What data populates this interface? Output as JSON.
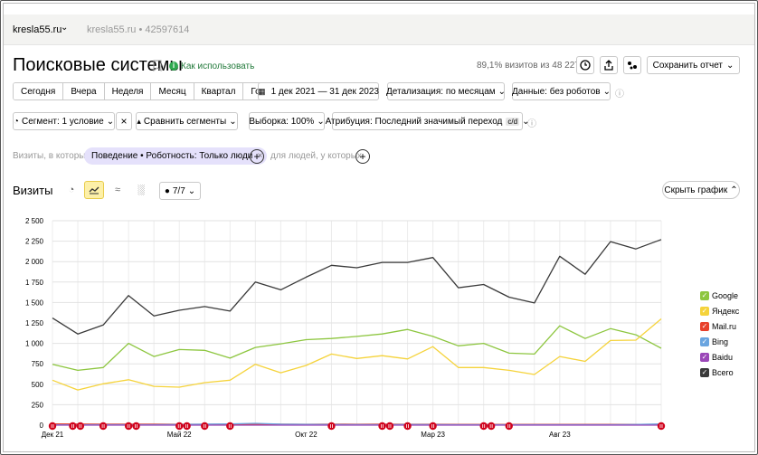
{
  "header": {
    "counter_name": "kresla55.ru",
    "counter_meta": "kresla55.ru • 42597614"
  },
  "page": {
    "title": "Поисковые системы",
    "howto": "Как использовать",
    "sample_info": "89,1% визитов из 48 227"
  },
  "toolbar": {
    "save_report": "Сохранить отчет"
  },
  "periods": [
    "Сегодня",
    "Вчера",
    "Неделя",
    "Месяц",
    "Квартал",
    "Год"
  ],
  "date_range": "1 дек 2021 — 31 дек 2023",
  "detail": "Детализация: по месяцам",
  "data_filter": "Данные: без роботов",
  "filters": {
    "segment": "Сегмент: 1 условие",
    "compare": "Сравнить сегменты",
    "sampling": "Выборка: 100%",
    "attribution": "Атрибуция: Последний значимый переход",
    "attribution_badge": "c/d"
  },
  "conditions": {
    "label": "Визиты, в которых",
    "chip": "Поведение • Роботность: Только люди",
    "people_label": "для людей, у которых"
  },
  "chart_header": {
    "title": "Визиты",
    "series_count": "7/7",
    "hide_chart": "Скрыть график"
  },
  "colors": {
    "google": "#8dc63f",
    "yandex": "#f5d33b",
    "mail": "#e8412c",
    "bing": "#6aa5e0",
    "baidu": "#9b48b8",
    "total": "#3a3a3a",
    "annotation": "#d0021b"
  },
  "chart_data": {
    "type": "line",
    "title": "",
    "xlabel": "",
    "ylabel": "",
    "ylim": [
      0,
      2500
    ],
    "yticks": [
      "0",
      "250",
      "500",
      "750",
      "1 000",
      "1 250",
      "1 500",
      "1 750",
      "2 000",
      "2 250",
      "2 500"
    ],
    "yvalues": [
      0,
      250,
      500,
      750,
      1000,
      1250,
      1500,
      1750,
      2000,
      2250,
      2500
    ],
    "xtick_labels": [
      {
        "label": "Дек 21",
        "index": 0
      },
      {
        "label": "Май 22",
        "index": 5
      },
      {
        "label": "Окт 22",
        "index": 10
      },
      {
        "label": "Мар 23",
        "index": 15
      },
      {
        "label": "Авг 23",
        "index": 20
      }
    ],
    "x": [
      "Дек 21",
      "Янв 22",
      "Фев 22",
      "Мар 22",
      "Апр 22",
      "Май 22",
      "Июн 22",
      "Июл 22",
      "Авг 22",
      "Сен 22",
      "Окт 22",
      "Ноя 22",
      "Дек 22",
      "Янв 23",
      "Фев 23",
      "Мар 23",
      "Апр 23",
      "Май 23",
      "Июн 23",
      "Июл 23",
      "Авг 23",
      "Сен 23",
      "Окт 23",
      "Ноя 23",
      "Дек 23"
    ],
    "legend_position": "right",
    "grid": true,
    "series": [
      {
        "name": "Google",
        "color": "#8dc63f",
        "values": [
          745,
          670,
          705,
          1000,
          840,
          925,
          915,
          820,
          950,
          995,
          1045,
          1060,
          1085,
          1115,
          1170,
          1085,
          970,
          1000,
          880,
          870,
          1215,
          1060,
          1180,
          1105,
          940
        ]
      },
      {
        "name": "Яндекс",
        "color": "#f5d33b",
        "values": [
          550,
          430,
          505,
          555,
          475,
          465,
          520,
          550,
          745,
          640,
          730,
          870,
          815,
          850,
          810,
          960,
          705,
          705,
          670,
          620,
          840,
          780,
          1035,
          1040,
          1300
        ]
      },
      {
        "name": "Mail.ru",
        "color": "#e8412c",
        "values": [
          14,
          13,
          12,
          12,
          12,
          11,
          11,
          12,
          13,
          12,
          11,
          12,
          11,
          12,
          11,
          11,
          10,
          10,
          10,
          9,
          10,
          10,
          10,
          10,
          11
        ]
      },
      {
        "name": "Bing",
        "color": "#6aa5e0",
        "values": [
          3,
          4,
          5,
          5,
          6,
          8,
          12,
          15,
          22,
          12,
          10,
          8,
          7,
          6,
          8,
          7,
          5,
          5,
          5,
          5,
          5,
          5,
          6,
          8,
          16
        ]
      },
      {
        "name": "Baidu",
        "color": "#9b48b8",
        "values": [
          0,
          0,
          0,
          0,
          0,
          0,
          0,
          0,
          0,
          0,
          0,
          0,
          0,
          0,
          0,
          0,
          0,
          0,
          0,
          0,
          0,
          0,
          0,
          0,
          0
        ]
      },
      {
        "name": "Всего",
        "color": "#3a3a3a",
        "values": [
          1310,
          1115,
          1225,
          1585,
          1335,
          1405,
          1450,
          1395,
          1750,
          1655,
          1810,
          1955,
          1925,
          1990,
          1990,
          2050,
          1680,
          1720,
          1565,
          1495,
          2065,
          1845,
          2245,
          2155,
          2270
        ]
      }
    ],
    "annotation_markers": [
      0.0,
      0.8,
      1.1,
      2.0,
      3.0,
      3.3,
      5.0,
      5.3,
      6.0,
      7.0,
      11.0,
      13.0,
      13.3,
      14.0,
      15.0,
      17.0,
      17.3,
      18.0,
      24.0
    ]
  }
}
